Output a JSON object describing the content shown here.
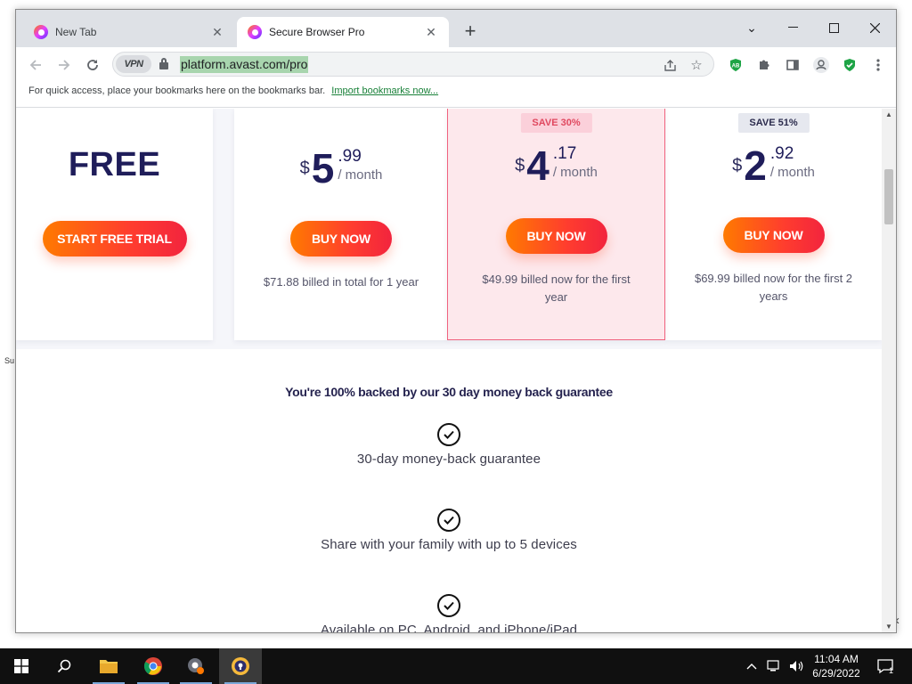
{
  "desktop": {
    "side_text": "Su"
  },
  "browser": {
    "tabs": [
      {
        "title": "New Tab",
        "active": false
      },
      {
        "title": "Secure Browser Pro",
        "active": true
      }
    ],
    "new_tab_label": "+",
    "window_controls": {
      "dropdown": "⌄",
      "minimize": "—",
      "maximize": "☐",
      "close": "✕"
    },
    "vpn_label": "VPN",
    "url": "platform.avast.com/pro",
    "bookmarks_bar": {
      "message": "For quick access, place your bookmarks here on the bookmarks bar.",
      "import_link": "Import bookmarks now..."
    }
  },
  "page": {
    "plans": [
      {
        "id": "free",
        "label": "FREE",
        "cta": "START FREE TRIAL"
      },
      {
        "id": "1yr",
        "currency": "$",
        "whole": "5",
        "cents": ".99",
        "period": "/ month",
        "cta": "BUY NOW",
        "billing": "$71.88 billed in total for 1 year"
      },
      {
        "id": "1yr-promo",
        "badge": "SAVE 30%",
        "currency": "$",
        "whole": "4",
        "cents": ".17",
        "period": "/ month",
        "cta": "BUY NOW",
        "billing": "$49.99 billed now for the first year"
      },
      {
        "id": "2yr",
        "badge": "SAVE 51%",
        "currency": "$",
        "whole": "2",
        "cents": ".92",
        "period": "/ month",
        "cta": "BUY NOW",
        "billing": "$69.99 billed now for the first 2 years"
      }
    ],
    "guarantee_title": "You're 100% backed by our 30 day money back guarantee",
    "features": [
      "30-day money-back guarantee",
      "Share with your family with up to 5 devices",
      "Available on PC, Android, and iPhone/iPad"
    ]
  },
  "taskbar": {
    "apps": [
      "windows-start",
      "search",
      "file-explorer",
      "google-chrome",
      "avast-app",
      "avast-secure-browser"
    ],
    "clock": {
      "time": "11:04 AM",
      "date": "6/29/2022"
    },
    "notification_count": "1"
  },
  "colors": {
    "accent_orange": "#ff7a00",
    "accent_red": "#f2243e",
    "price_navy": "#1f1d5a",
    "highlight_pink": "#fde8ec"
  }
}
